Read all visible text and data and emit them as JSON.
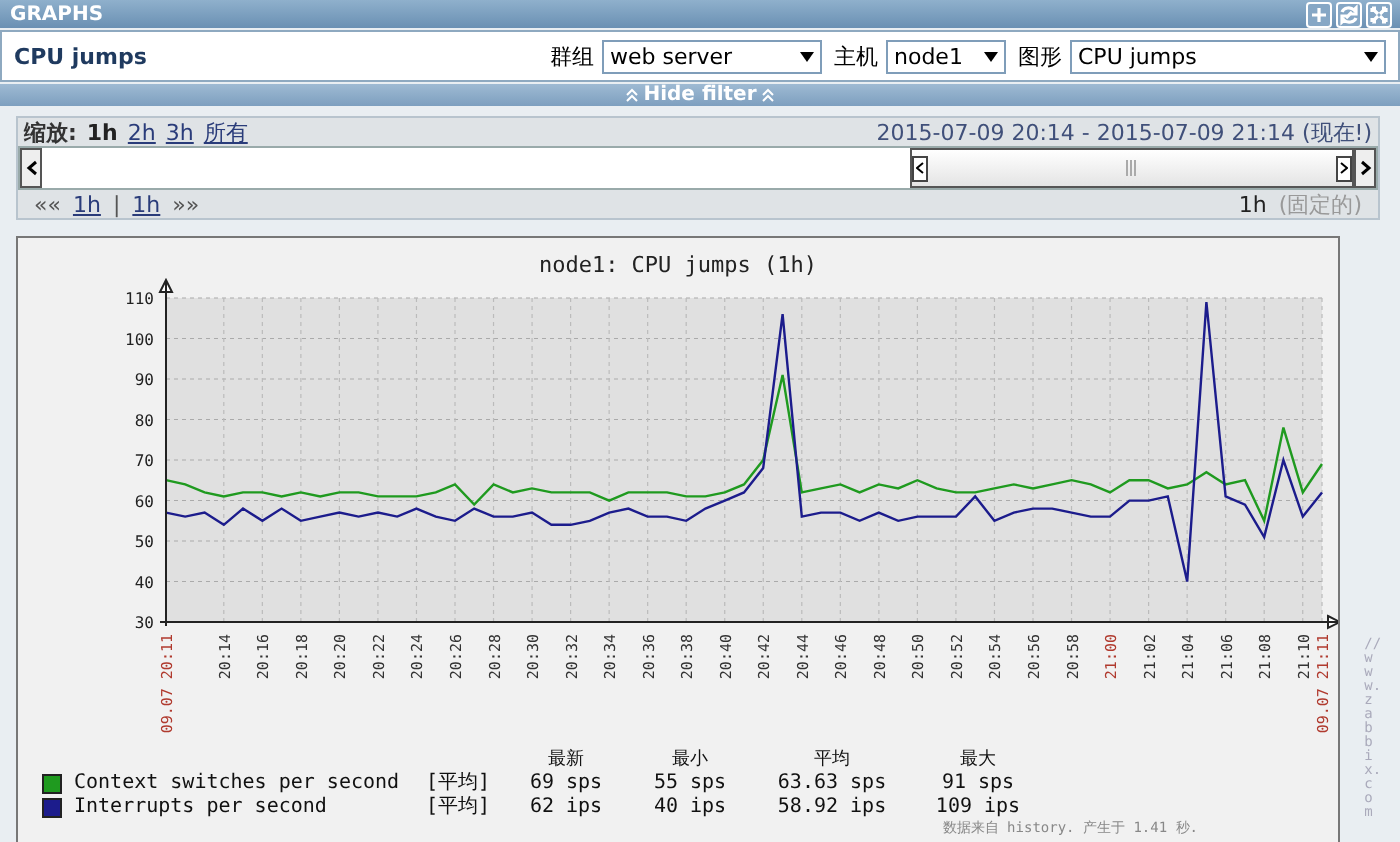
{
  "header": {
    "title": "GRAPHS"
  },
  "page": {
    "title": "CPU jumps"
  },
  "selectors": [
    {
      "label": "群组",
      "value": "web server"
    },
    {
      "label": "主机",
      "value": "node1"
    },
    {
      "label": "图形",
      "value": "CPU jumps"
    }
  ],
  "filter_toggle": {
    "label": "Hide filter"
  },
  "zoom": {
    "label": "缩放:",
    "options": [
      {
        "label": "1h",
        "selected": true
      },
      {
        "label": "2h",
        "selected": false
      },
      {
        "label": "3h",
        "selected": false
      },
      {
        "label": "所有",
        "selected": false
      }
    ]
  },
  "period": "2015-07-09 20:14  -  2015-07-09 21:14 (现在!)",
  "nav": {
    "back": "««",
    "back_step": "1h",
    "separator": "|",
    "forward_step": "1h",
    "forward": "»»",
    "length": "1h",
    "mode": "(固定的)"
  },
  "graph": {
    "chart_data": {
      "type": "line",
      "title": "node1: CPU jumps (1h)",
      "ylim": [
        30,
        110
      ],
      "yticks": [
        30,
        40,
        50,
        60,
        70,
        80,
        90,
        100,
        110
      ],
      "grid": true,
      "legend": "bottom",
      "categories": [
        "09.07 20:11",
        null,
        null,
        "20:14",
        null,
        "20:16",
        null,
        "20:18",
        null,
        "20:20",
        null,
        "20:22",
        null,
        "20:24",
        null,
        "20:26",
        null,
        "20:28",
        null,
        "20:30",
        null,
        "20:32",
        null,
        "20:34",
        null,
        "20:36",
        null,
        "20:38",
        null,
        "20:40",
        null,
        "20:42",
        null,
        "20:44",
        null,
        "20:46",
        null,
        "20:48",
        null,
        "20:50",
        null,
        "20:52",
        null,
        "20:54",
        null,
        "20:56",
        null,
        "20:58",
        null,
        "21:00",
        null,
        "21:02",
        null,
        "21:04",
        null,
        "21:06",
        null,
        "21:08",
        null,
        "21:10",
        "09.07 21:11"
      ],
      "series": [
        {
          "name": "Context switches per second",
          "color": "#1f9a1f",
          "values": [
            65,
            64,
            62,
            61,
            62,
            62,
            61,
            62,
            61,
            62,
            62,
            61,
            61,
            61,
            62,
            64,
            59,
            64,
            62,
            63,
            62,
            62,
            62,
            60,
            62,
            62,
            62,
            61,
            61,
            62,
            64,
            70,
            91,
            62,
            63,
            64,
            62,
            64,
            63,
            65,
            63,
            62,
            62,
            63,
            64,
            63,
            64,
            65,
            64,
            62,
            65,
            65,
            63,
            64,
            67,
            64,
            65,
            55,
            78,
            62,
            69
          ]
        },
        {
          "name": "Interrupts per second",
          "color": "#1c1c8c",
          "values": [
            57,
            56,
            57,
            54,
            58,
            55,
            58,
            55,
            56,
            57,
            56,
            57,
            56,
            58,
            56,
            55,
            58,
            56,
            56,
            57,
            54,
            54,
            55,
            57,
            58,
            56,
            56,
            55,
            58,
            60,
            62,
            68,
            106,
            56,
            57,
            57,
            55,
            57,
            55,
            56,
            56,
            56,
            61,
            55,
            57,
            58,
            58,
            57,
            56,
            56,
            60,
            60,
            61,
            40,
            109,
            61,
            59,
            51,
            70,
            56,
            62
          ]
        }
      ]
    },
    "tick_highlights": [
      true,
      false,
      false,
      false,
      false,
      false,
      false,
      false,
      false,
      false,
      false,
      false,
      false,
      false,
      false,
      false,
      false,
      false,
      false,
      false,
      false,
      false,
      false,
      false,
      true,
      false,
      false,
      false,
      false,
      false,
      true
    ],
    "legend": {
      "columns": [
        "最新",
        "最小",
        "平均",
        "最大"
      ],
      "rows": [
        {
          "function": "[平均]",
          "values": [
            "69 sps",
            "55 sps",
            "63.63 sps",
            "91 sps"
          ]
        },
        {
          "function": "[平均]",
          "values": [
            "62 ips",
            "40 ips",
            "58.92 ips",
            "109 ips"
          ]
        }
      ]
    },
    "source_url": "//www.zabbix.com",
    "footer_note": "数据来自 history. 产生于 1.41 秒."
  }
}
